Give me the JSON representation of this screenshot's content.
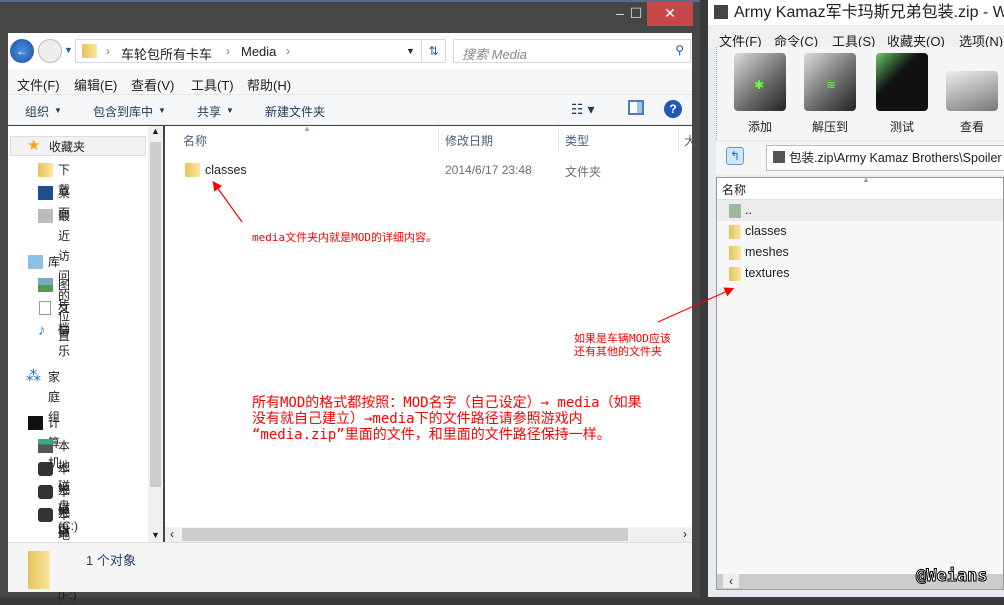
{
  "explorer": {
    "breadcrumb": [
      "车轮包所有卡车",
      "Media"
    ],
    "search_placeholder": "搜索 Media",
    "menu": [
      "文件(F)",
      "编辑(E)",
      "查看(V)",
      "工具(T)",
      "帮助(H)"
    ],
    "toolbar": [
      "组织",
      "包含到库中",
      "共享",
      "新建文件夹"
    ],
    "nav": {
      "favorites": "收藏夹",
      "downloads": "下载",
      "desktop": "桌面",
      "recent": "最近访问的位置",
      "libraries": "库",
      "pictures": "图片",
      "documents": "文档",
      "music": "音乐",
      "homegroup": "家庭组",
      "computer": "计算机",
      "drives": [
        "本地磁盘 (C:)",
        "本地磁盘 (D:)",
        "本地磁盘 (E:)",
        "本地磁盘 (F:)"
      ]
    },
    "columns": [
      "名称",
      "修改日期",
      "类型",
      "大"
    ],
    "files": [
      {
        "name": "classes",
        "date": "2014/6/17 23:48",
        "type": "文件夹"
      }
    ],
    "status": "1 个对象"
  },
  "winrar": {
    "title": "Army Kamaz军卡玛斯兄弟包装.zip - WinRAR",
    "menu": [
      "文件(F)",
      "命令(C)",
      "工具(S)",
      "收藏夹(O)",
      "选项(N)"
    ],
    "toolbar": [
      "添加",
      "解压到",
      "测试",
      "查看"
    ],
    "path": "包装.zip\\Army Kamaz Brothers\\Spoiler",
    "column": "名称",
    "items": [
      "..",
      "classes",
      "meshes",
      "textures"
    ]
  },
  "annotations": {
    "note1": "media文件夹内就是MOD的详细内容。",
    "note2_line1": "如果是车辆MOD应该",
    "note2_line2": "还有其他的文件夹",
    "note3_line1": "所有MOD的格式都按照：MOD名字（自己设定）→ media（如果",
    "note3_line2": "没有就自己建立）→media下的文件路径请参照游戏内",
    "note3_line3": "“media.zip”里面的文件，和里面的文件路径保持一样。"
  },
  "watermark": "@Weians"
}
